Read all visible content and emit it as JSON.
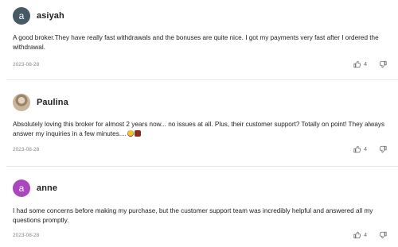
{
  "reviews": [
    {
      "author": "asiyah",
      "avatar_letter": "a",
      "avatar_color": "#455a64",
      "text": "A good broker.They have really fast withdrawals and the bonuses are quite nice. I got my payments very fast after I ordered the withdrawal.",
      "date": "2023-08-28",
      "likes": "4"
    },
    {
      "author": "Paulina",
      "avatar_letter": "",
      "avatar_color": "#b9a78e",
      "text": "Absolutely loving this broker for almost 2 years now... no issues at all. Plus, their customer support? Totally on point! They always answer my inquiries in a few minutes....",
      "emoji": [
        "face-emoji",
        "gift-emoji"
      ],
      "date": "2023-08-28",
      "likes": "4"
    },
    {
      "author": "anne",
      "avatar_letter": "a",
      "avatar_color": "#ab47bc",
      "text": "I had some concerns before making my purchase, but the customer support team was incredibly helpful and answered all my questions promptly.",
      "date": "2023-08-28",
      "likes": "4"
    }
  ],
  "icons": {
    "like": "thumbs-up-icon",
    "dislike": "thumbs-down-icon"
  }
}
